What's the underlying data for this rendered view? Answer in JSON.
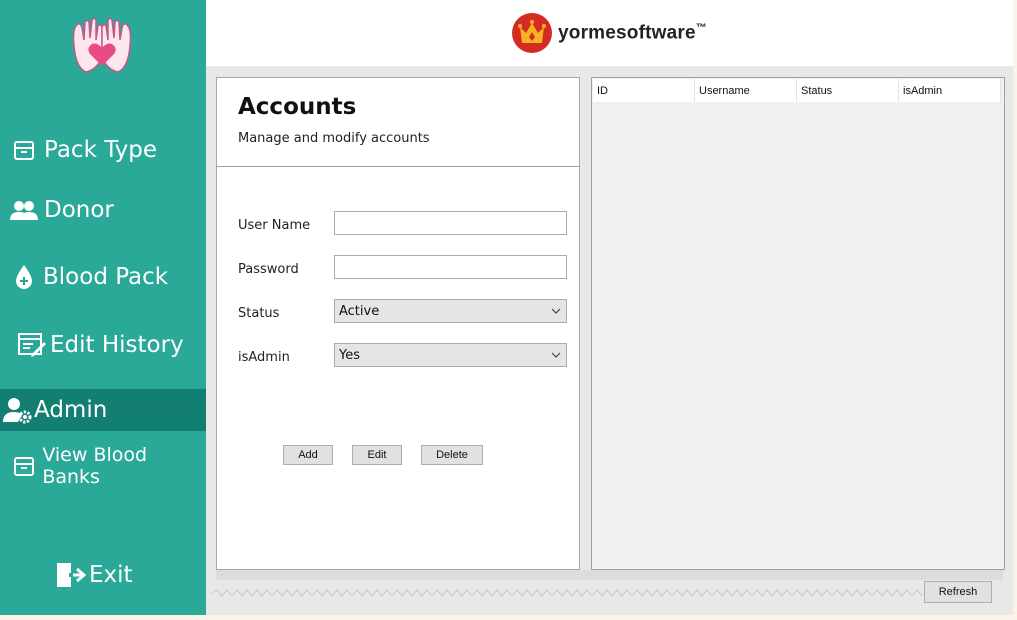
{
  "brand": {
    "name": "yormesoftware",
    "trademark": "™"
  },
  "sidebar": {
    "items": [
      {
        "label": "Pack Type",
        "icon": "pack-icon"
      },
      {
        "label": "Donor",
        "icon": "users-icon"
      },
      {
        "label": "Blood Pack",
        "icon": "blood-drop-icon"
      },
      {
        "label": "Edit History",
        "icon": "edit-history-icon"
      },
      {
        "label": "Admin",
        "icon": "admin-gear-icon",
        "active": true
      },
      {
        "label": "View Blood Banks",
        "icon": "bank-icon"
      }
    ],
    "exit_label": "Exit"
  },
  "accounts": {
    "title": "Accounts",
    "subtitle": "Manage and modify accounts",
    "fields": {
      "username_label": "User Name",
      "username_value": "",
      "password_label": "Password",
      "password_value": "",
      "status_label": "Status",
      "status_value": "Active",
      "isadmin_label": "isAdmin",
      "isadmin_value": "Yes"
    },
    "buttons": {
      "add": "Add",
      "edit": "Edit",
      "delete": "Delete"
    }
  },
  "grid": {
    "columns": [
      "ID",
      "Username",
      "Status",
      "isAdmin"
    ]
  },
  "refresh_label": "Refresh",
  "colors": {
    "sidebar": "#2aa898",
    "sidebar_active": "#137f72",
    "brand_red": "#d42b25",
    "brand_gold": "#f5b324"
  }
}
